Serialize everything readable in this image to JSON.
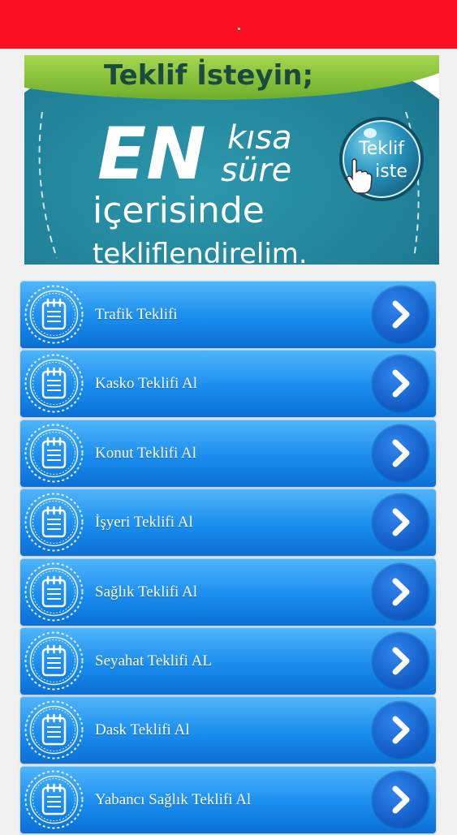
{
  "banner": {
    "headline": "Teklif İsteyin;",
    "big_letters": "EN",
    "word_kisa": "kısa",
    "word_sure": "süre",
    "line_icerisinde": "içerisinde",
    "line_teklif": "tekliflendirelim.",
    "button_line1": "Teklif",
    "button_line2": "iste"
  },
  "colors": {
    "status_bar": "#fb0f23",
    "banner_teal": "#1f7f96",
    "banner_green": "#86c437",
    "item_blue": "#1b8dee",
    "arrow_circle": "#1466d4"
  },
  "menu": {
    "items": [
      {
        "label": "Trafik Teklifi",
        "icon": "notepad-icon",
        "action_icon": "chevron-right-icon"
      },
      {
        "label": "Kasko Teklifi Al",
        "icon": "notepad-icon",
        "action_icon": "chevron-right-icon"
      },
      {
        "label": "Konut Teklifi Al",
        "icon": "notepad-icon",
        "action_icon": "chevron-right-icon"
      },
      {
        "label": "İşyeri Teklifi Al",
        "icon": "notepad-icon",
        "action_icon": "chevron-right-icon"
      },
      {
        "label": "Sağlık Teklifi Al",
        "icon": "notepad-icon",
        "action_icon": "chevron-right-icon"
      },
      {
        "label": "Seyahat Teklifi AL",
        "icon": "notepad-icon",
        "action_icon": "chevron-right-icon"
      },
      {
        "label": "Dask Teklifi Al",
        "icon": "notepad-icon",
        "action_icon": "chevron-right-icon"
      },
      {
        "label": "Yabancı Sağlık Teklifi Al",
        "icon": "notepad-icon",
        "action_icon": "chevron-right-icon"
      }
    ]
  }
}
